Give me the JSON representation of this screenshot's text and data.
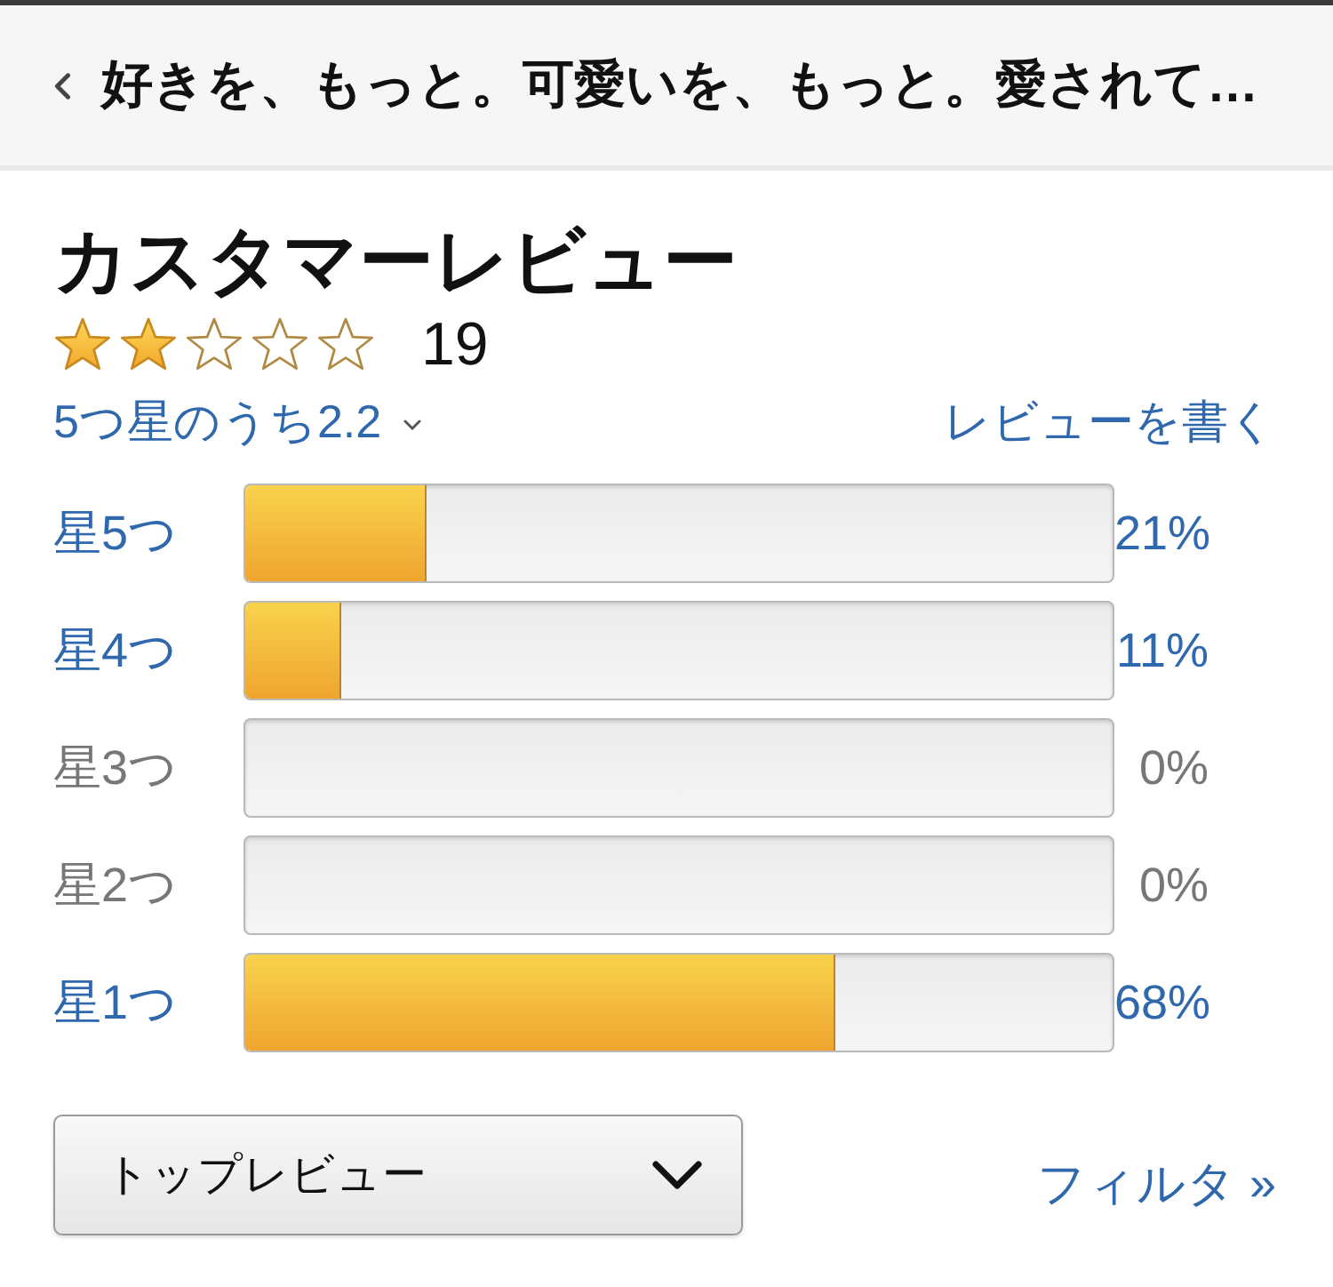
{
  "header": {
    "title": "好きを、もっと。可愛いを、もっと。愛されて…"
  },
  "reviews": {
    "title": "カスタマーレビュー",
    "stars": 2,
    "count": "19",
    "rating_link": "5つ星のうち2.2",
    "write_review": "レビューを書く"
  },
  "histogram": [
    {
      "label": "星5つ",
      "level": 0.21,
      "reading": "21%",
      "disabled": false
    },
    {
      "label": "星4つ",
      "level": 0.11,
      "reading": "11%",
      "disabled": false
    },
    {
      "label": "星3つ",
      "reading": "0%",
      "disabled": true
    },
    {
      "label": "星2つ",
      "reading": "0%",
      "disabled": true
    },
    {
      "label": "星1つ",
      "level": 0.68,
      "reading": "68%",
      "disabled": false
    }
  ],
  "sort": {
    "value": "トップレビュー"
  },
  "filter": {
    "label": "フィルタ »"
  }
}
